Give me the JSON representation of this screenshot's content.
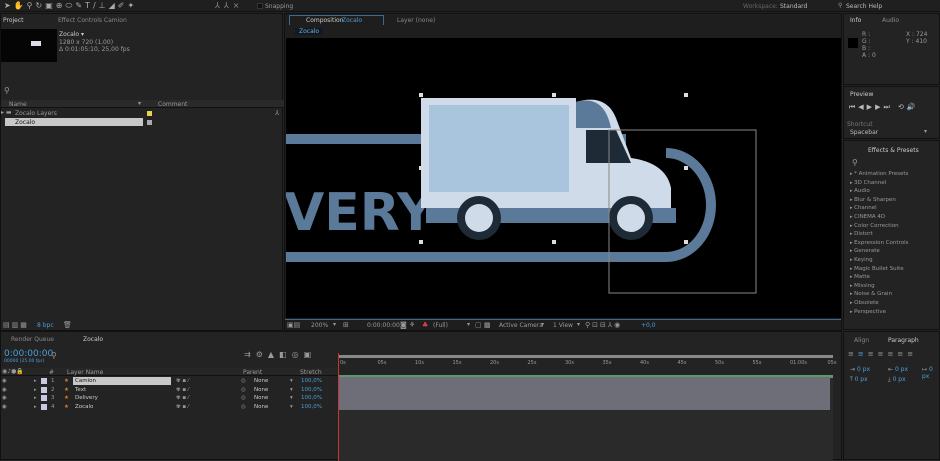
{
  "toolbar": {
    "snapping": "Snapping",
    "workspace_label": "Workspace:",
    "workspace": "Standard",
    "search_help": "Search Help"
  },
  "project": {
    "tab": "Project",
    "effect_controls_tab": "Effect Controls Camion",
    "comp_name": "Zocalo ▾",
    "comp_size": "1280 x 720 (1,00)",
    "comp_duration": "Δ 0:01:05:10, 25,00 fps",
    "col_name": "Name",
    "col_comment": "Comment",
    "items": [
      {
        "name": "Zocalo Layers",
        "type": "folder"
      },
      {
        "name": "Zocalo",
        "type": "comp"
      }
    ],
    "bpc": "8 bpc"
  },
  "viewer": {
    "tab_prefix": "Composition",
    "tab_comp": "Zocalo",
    "layer_tab": "Layer (none)",
    "breadcrumb": "Zocalo",
    "art_text": "VERY",
    "zoom": "200%",
    "timecode": "0:00:00:00",
    "resolution": "(Full)",
    "camera": "Active Camera",
    "views": "1 View",
    "exposure": "+0,0"
  },
  "info": {
    "tab": "Info",
    "audio_tab": "Audio",
    "r": "R :",
    "g": "G :",
    "b": "B :",
    "a": "A : 0",
    "x": "X : 724",
    "y": "Y : 410"
  },
  "preview": {
    "tab": "Preview",
    "shortcut_label": "Shortcut",
    "shortcut": "Spacebar"
  },
  "effects": {
    "tab": "Effects & Presets",
    "items": [
      "* Animation Presets",
      "3D Channel",
      "Audio",
      "Blur & Sharpen",
      "Channel",
      "CINEMA 4D",
      "Color Correction",
      "Distort",
      "Expression Controls",
      "Generate",
      "Keying",
      "Magic Bullet Suite",
      "Matte",
      "Missing",
      "Noise & Grain",
      "Obsolete",
      "Perspective"
    ]
  },
  "timeline": {
    "render_queue_tab": "Render Queue",
    "comp_tab": "Zocalo",
    "timecode": "0:00:00:00",
    "fps": "00000 (25.00 fps)",
    "col_layer_name": "Layer Name",
    "col_parent": "Parent",
    "col_stretch": "Stretch",
    "col_num": "#",
    "layers": [
      {
        "num": "1",
        "name": "Camion",
        "parent": "None",
        "stretch": "100,0%"
      },
      {
        "num": "2",
        "name": "Text",
        "parent": "None",
        "stretch": "100,0%"
      },
      {
        "num": "3",
        "name": "Delivery",
        "parent": "None",
        "stretch": "100,0%"
      },
      {
        "num": "4",
        "name": "Zocalo",
        "parent": "None",
        "stretch": "100,0%"
      }
    ],
    "ruler": [
      "0s",
      "05s",
      "10s",
      "15s",
      "20s",
      "25s",
      "30s",
      "35s",
      "40s",
      "45s",
      "50s",
      "55s",
      "01:00s",
      "05s"
    ]
  },
  "align": {
    "tab": "Align",
    "paragraph_tab": "Paragraph",
    "indent_left": "0 px",
    "indent_right": "0 px",
    "indent_first": "0 px",
    "space_before": "0 px",
    "space_after": "0 px"
  },
  "colors": {
    "accent": "#4a9fd8",
    "truck_body": "#cfdbe8",
    "truck_blue": "#5b7a99",
    "timeline_bar": "#6e6e78"
  }
}
